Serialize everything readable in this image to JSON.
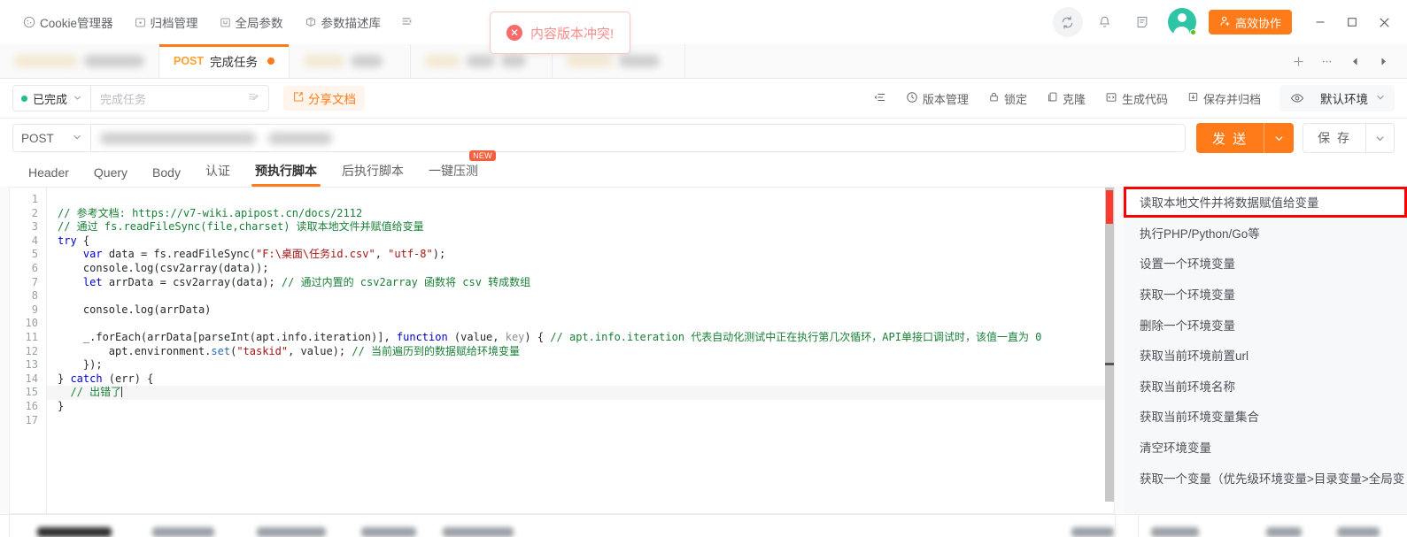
{
  "topmenu": {
    "items": [
      {
        "label": "Cookie管理器",
        "icon": "cookie-icon"
      },
      {
        "label": "归档管理",
        "icon": "archive-icon"
      },
      {
        "label": "全局参数",
        "icon": "global-params-icon"
      },
      {
        "label": "参数描述库",
        "icon": "param-library-icon"
      }
    ],
    "more_icon": "list-collapse-icon"
  },
  "topright": {
    "sync_icon": "sync-icon",
    "bell_icon": "bell-icon",
    "note_icon": "note-icon",
    "avatar": "user-avatar",
    "collab_label": "高效协作",
    "collab_icon": "user-plus-icon",
    "minimize": "—",
    "maximize": "□",
    "close": "✕",
    "accent_color": "#ff7a18"
  },
  "toast": {
    "message": "内容版本冲突!",
    "icon": "error-circle-icon",
    "color": "#f98c8c",
    "border_color": "#fbc4c4"
  },
  "tabs": {
    "active": {
      "method": "POST",
      "label": "完成任务",
      "dirty": true
    },
    "blurred_count": 4,
    "actions": {
      "add": "+",
      "more": "···",
      "prev": "◀",
      "next": "▶"
    }
  },
  "actionbar": {
    "status_label": "已完成",
    "status_color": "#1fbf86",
    "name_placeholder": "完成任务",
    "name_value": "",
    "edit_icon": "edit-note-icon",
    "share_label": "分享文档",
    "share_icon": "share-icon",
    "items": [
      {
        "label": "版本管理",
        "icon": "clock-icon"
      },
      {
        "label": "锁定",
        "icon": "lock-icon"
      },
      {
        "label": "克隆",
        "icon": "copy-icon"
      },
      {
        "label": "生成代码",
        "icon": "code-icon"
      },
      {
        "label": "保存并归档",
        "icon": "save-archive-icon"
      }
    ],
    "collapse_icon": "collapse-icon",
    "env_icon": "eye-icon",
    "env_name": "默认环境"
  },
  "urlbar": {
    "method": "POST",
    "url_value": "",
    "send_label": "发 送",
    "save_label": "保 存"
  },
  "sectabs": {
    "items": [
      {
        "label": "Header",
        "active": false
      },
      {
        "label": "Query",
        "active": false
      },
      {
        "label": "Body",
        "active": false
      },
      {
        "label": "认证",
        "active": false
      },
      {
        "label": "预执行脚本",
        "active": true
      },
      {
        "label": "后执行脚本",
        "active": false
      },
      {
        "label": "一键压测",
        "active": false,
        "badge": "NEW"
      }
    ]
  },
  "editor": {
    "line_numbers": [
      "1",
      "2",
      "3",
      "4",
      "5",
      "6",
      "7",
      "8",
      "9",
      "10",
      "11",
      "12",
      "13",
      "14",
      "15",
      "16",
      "17"
    ],
    "cursor_line": 15,
    "lines": [
      {
        "n": 1,
        "tokens": []
      },
      {
        "n": 2,
        "tokens": [
          {
            "t": "cmt",
            "s": "// 参考文档: https://v7-wiki.apipost.cn/docs/2112"
          }
        ]
      },
      {
        "n": 3,
        "tokens": [
          {
            "t": "cmt",
            "s": "// 通过 fs.readFileSync(file,charset) 读取本地文件并赋值给变量"
          }
        ]
      },
      {
        "n": 4,
        "tokens": [
          {
            "t": "kw",
            "s": "try"
          },
          {
            "t": "plain",
            "s": " {"
          }
        ]
      },
      {
        "n": 5,
        "tokens": [
          {
            "t": "plain",
            "s": "    "
          },
          {
            "t": "kw",
            "s": "var"
          },
          {
            "t": "plain",
            "s": " data = fs.readFileSync("
          },
          {
            "t": "str",
            "s": "\"F:\\桌面\\任务id.csv\""
          },
          {
            "t": "plain",
            "s": ", "
          },
          {
            "t": "str",
            "s": "\"utf-8\""
          },
          {
            "t": "plain",
            "s": ");"
          }
        ]
      },
      {
        "n": 6,
        "tokens": [
          {
            "t": "plain",
            "s": "    console.log(csv2array(data));"
          }
        ]
      },
      {
        "n": 7,
        "tokens": [
          {
            "t": "plain",
            "s": "    "
          },
          {
            "t": "kw",
            "s": "let"
          },
          {
            "t": "plain",
            "s": " arrData = csv2array(data); "
          },
          {
            "t": "cmt",
            "s": "// 通过内置的 csv2array 函数将 csv 转成数组"
          }
        ]
      },
      {
        "n": 8,
        "tokens": []
      },
      {
        "n": 9,
        "tokens": [
          {
            "t": "plain",
            "s": "    console.log(arrData)"
          }
        ]
      },
      {
        "n": 10,
        "tokens": []
      },
      {
        "n": 11,
        "tokens": [
          {
            "t": "plain",
            "s": "    _.forEach(arrData[parseInt(apt.info.iteration)], "
          },
          {
            "t": "kw",
            "s": "function"
          },
          {
            "t": "plain",
            "s": " (value, "
          },
          {
            "t": "var",
            "s": "key"
          },
          {
            "t": "plain",
            "s": ") { "
          },
          {
            "t": "cmt",
            "s": "// apt.info.iteration 代表自动化测试中正在执行第几次循环，API单接口调试时，该值一直为 0"
          }
        ]
      },
      {
        "n": 12,
        "tokens": [
          {
            "t": "plain",
            "s": "        apt.environment."
          },
          {
            "t": "fn",
            "s": "set"
          },
          {
            "t": "plain",
            "s": "("
          },
          {
            "t": "str",
            "s": "\"taskid\""
          },
          {
            "t": "plain",
            "s": ", value); "
          },
          {
            "t": "cmt",
            "s": "// 当前遍历到的数据赋给环境变量"
          }
        ]
      },
      {
        "n": 13,
        "tokens": [
          {
            "t": "plain",
            "s": "    });"
          }
        ]
      },
      {
        "n": 14,
        "tokens": [
          {
            "t": "plain",
            "s": "} "
          },
          {
            "t": "kw",
            "s": "catch"
          },
          {
            "t": "plain",
            "s": " (err) {"
          }
        ]
      },
      {
        "n": 15,
        "tokens": [
          {
            "t": "plain",
            "s": "  "
          },
          {
            "t": "cmt",
            "s": "// 出错了"
          },
          {
            "t": "caret",
            "s": ""
          }
        ]
      },
      {
        "n": 16,
        "tokens": [
          {
            "t": "plain",
            "s": "}"
          }
        ]
      },
      {
        "n": 17,
        "tokens": []
      }
    ]
  },
  "snippets": {
    "highlight_index": 0,
    "highlight_color": "#ff0000",
    "items": [
      "读取本地文件并将数据赋值给变量",
      "执行PHP/Python/Go等",
      "设置一个环境变量",
      "获取一个环境变量",
      "删除一个环境变量",
      "获取当前环境前置url",
      "获取当前环境名称",
      "获取当前环境变量集合",
      "清空环境变量",
      "获取一个变量（优先级环境变量>目录变量>全局变"
    ]
  }
}
